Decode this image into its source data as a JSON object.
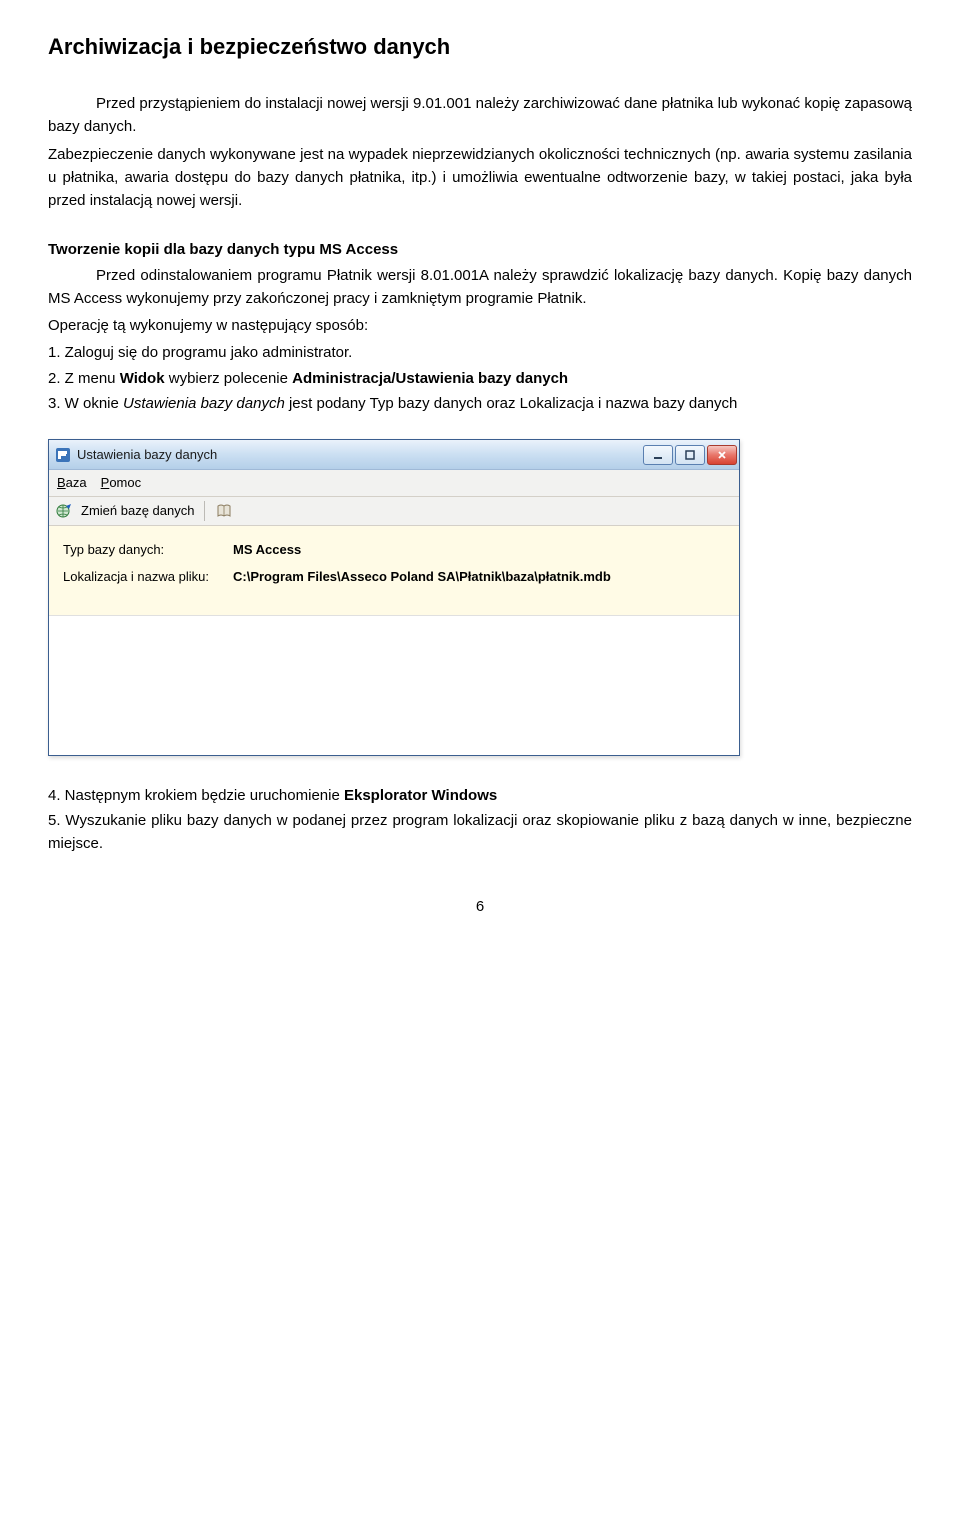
{
  "heading": "Archiwizacja i bezpieczeństwo danych",
  "para1": "Przed przystąpieniem do instalacji nowej wersji 9.01.001 należy zarchiwizować dane płatnika lub wykonać kopię zapasową bazy danych.",
  "para2": "Zabezpieczenie danych wykonywane jest na wypadek nieprzewidzianych okoliczności technicznych (np. awaria systemu zasilania u płatnika, awaria dostępu do bazy danych płatnika, itp.) i umożliwia ewentualne odtworzenie bazy, w takiej postaci, jaka była przed instalacją nowej wersji.",
  "subheading": "Tworzenie kopii dla bazy danych typu MS Access",
  "para3": "Przed odinstalowaniem programu Płatnik wersji 8.01.001A należy sprawdzić lokalizację bazy danych. Kopię bazy danych MS Access wykonujemy przy zakończonej pracy i zamkniętym programie Płatnik.",
  "op_intro": "Operację tą wykonujemy w następujący sposób:",
  "step1": "1. Zaloguj się do programu jako administrator.",
  "step2_pre": "2. Z menu ",
  "step2_b1": "Widok",
  "step2_mid": " wybierz polecenie ",
  "step2_b2": "Administracja/Ustawienia bazy danych",
  "step3_pre": "3. W oknie ",
  "step3_it": "Ustawienia bazy danych",
  "step3_post": " jest podany Typ bazy danych oraz Lokalizacja i nazwa bazy danych",
  "window": {
    "title": "Ustawienia bazy danych",
    "menu": {
      "baza_u": "B",
      "baza_rest": "aza",
      "pomoc_u": "P",
      "pomoc_rest": "omoc"
    },
    "toolbar": {
      "zmien_pre": "Z",
      "zmien_u": "m",
      "zmien_post": "ień bazę danych"
    },
    "rows": {
      "typ_label": "Typ bazy danych:",
      "typ_value": "MS Access",
      "lok_label": "Lokalizacja i nazwa pliku:",
      "lok_value": "C:\\Program Files\\Asseco Poland SA\\Płatnik\\baza\\płatnik.mdb"
    }
  },
  "step4_pre": "4. Następnym krokiem będzie uruchomienie ",
  "step4_b": "Eksplorator Windows",
  "step5": "5. Wyszukanie pliku bazy danych w podanej przez program lokalizacji oraz skopiowanie pliku z bazą danych w inne, bezpieczne miejsce.",
  "page_number": "6"
}
